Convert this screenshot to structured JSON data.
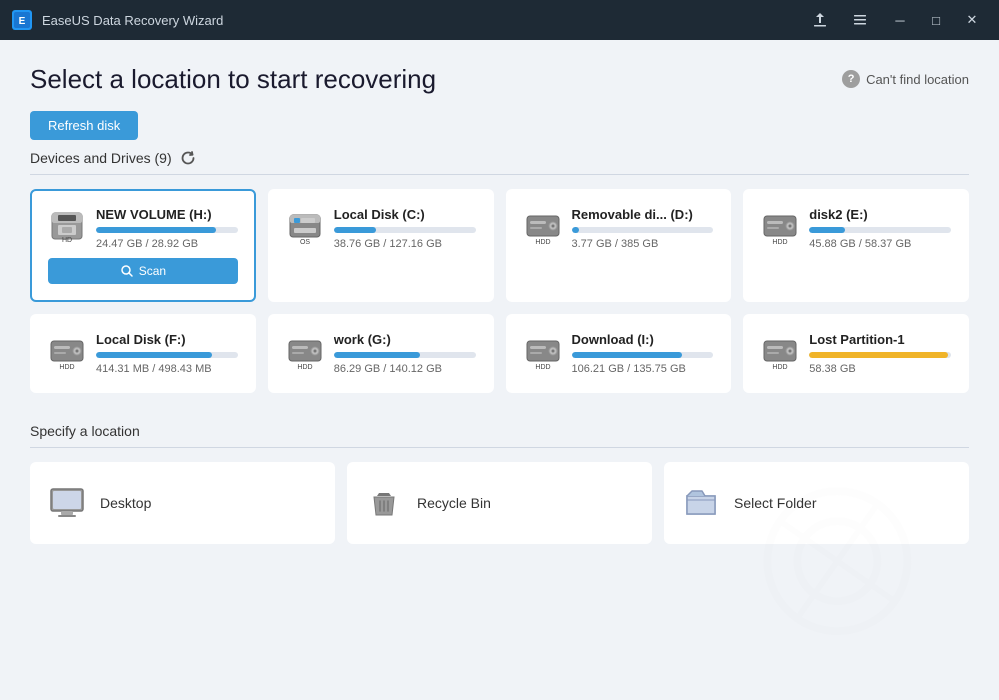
{
  "titlebar": {
    "logo": "E",
    "title": "EaseUS Data Recovery Wizard",
    "controls": {
      "upload": "⬆",
      "menu": "≡",
      "minimize": "—",
      "maximize": "□",
      "close": "✕"
    }
  },
  "header": {
    "title": "Select a location to start recovering",
    "cant_find_label": "Can't find location"
  },
  "devices_section": {
    "title": "Devices and Drives (9)",
    "refresh_label": "Refresh disk"
  },
  "drives": [
    {
      "name": "NEW VOLUME  (H:)",
      "size": "24.47 GB / 28.92 GB",
      "fill_pct": 85,
      "color": "#3a9ad9",
      "type": "floppy",
      "selected": true,
      "scan_label": "Scan"
    },
    {
      "name": "Local Disk (C:)",
      "size": "38.76 GB / 127.16 GB",
      "fill_pct": 30,
      "color": "#3a9ad9",
      "type": "windows",
      "selected": false
    },
    {
      "name": "Removable di... (D:)",
      "size": "3.77 GB / 385 GB",
      "fill_pct": 5,
      "color": "#3a9ad9",
      "type": "hdd",
      "selected": false
    },
    {
      "name": "disk2 (E:)",
      "size": "45.88 GB / 58.37 GB",
      "fill_pct": 25,
      "color": "#3a9ad9",
      "type": "hdd",
      "selected": false
    },
    {
      "name": "Local Disk (F:)",
      "size": "414.31 MB / 498.43 MB",
      "fill_pct": 82,
      "color": "#3a9ad9",
      "type": "hdd",
      "selected": false
    },
    {
      "name": "work (G:)",
      "size": "86.29 GB / 140.12 GB",
      "fill_pct": 61,
      "color": "#3a9ad9",
      "type": "hdd",
      "selected": false
    },
    {
      "name": "Download (I:)",
      "size": "106.21 GB / 135.75 GB",
      "fill_pct": 78,
      "color": "#3a9ad9",
      "type": "hdd",
      "selected": false
    },
    {
      "name": "Lost Partition-1",
      "size": "58.38 GB",
      "fill_pct": 98,
      "color": "#f0b429",
      "type": "hdd",
      "selected": false
    }
  ],
  "specify_section": {
    "title": "Specify a location",
    "locations": [
      {
        "name": "Desktop",
        "icon_type": "desktop"
      },
      {
        "name": "Recycle Bin",
        "icon_type": "recycle"
      },
      {
        "name": "Select Folder",
        "icon_type": "folder"
      }
    ]
  }
}
